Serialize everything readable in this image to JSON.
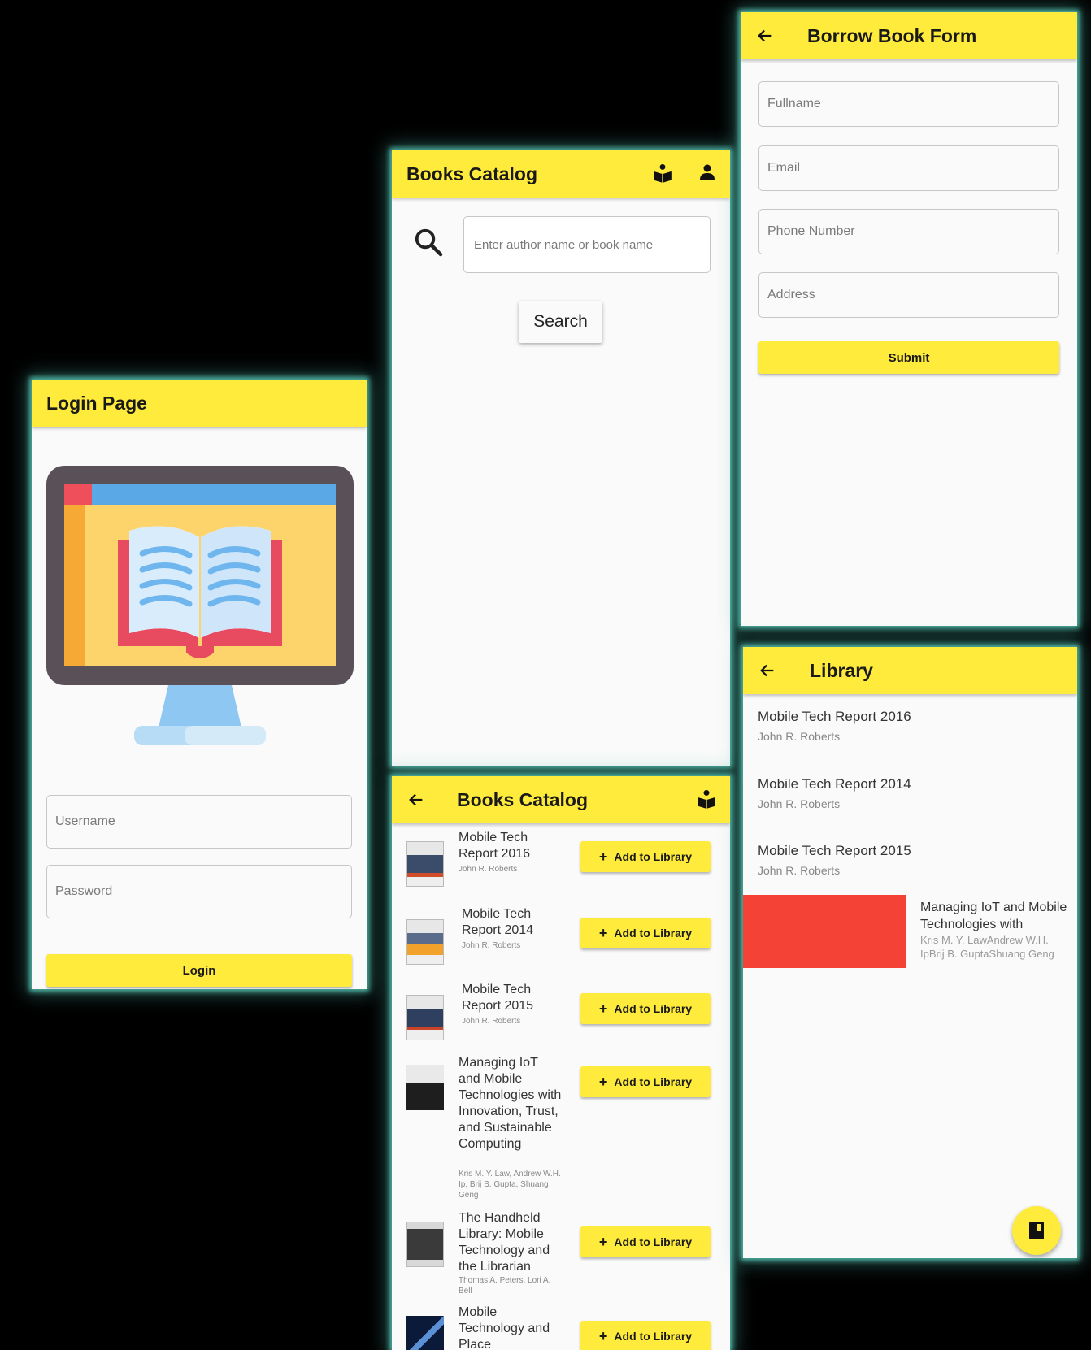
{
  "login": {
    "title": "Login Page",
    "username_placeholder": "Username",
    "password_placeholder": "Password",
    "login_label": "Login"
  },
  "catalog_search": {
    "title": "Books Catalog",
    "search_placeholder": "Enter author name or book name",
    "search_label": "Search"
  },
  "catalog_results": {
    "title": "Books Catalog",
    "add_label": "Add to Library",
    "books": [
      {
        "title": "Mobile Tech Report 2016",
        "author": "John R. Roberts"
      },
      {
        "title": "Mobile Tech Report 2014",
        "author": "John R. Roberts"
      },
      {
        "title": "Mobile Tech Report 2015",
        "author": "John R. Roberts"
      },
      {
        "title": "Managing IoT and Mobile Technologies with Innovation, Trust, and Sustainable Computing",
        "author": "Kris M. Y. Law, Andrew W.H. Ip, Brij B. Gupta, Shuang Geng"
      },
      {
        "title": "The Handheld Library: Mobile Technology and the Librarian",
        "author": "Thomas A. Peters, Lori A. Bell"
      },
      {
        "title": "Mobile Technology and Place",
        "author": ""
      }
    ]
  },
  "borrow_form": {
    "title": "Borrow Book Form",
    "fullname_placeholder": "Fullname",
    "email_placeholder": "Email",
    "phone_placeholder": "Phone Number",
    "address_placeholder": "Address",
    "submit_label": "Submit"
  },
  "library": {
    "title": "Library",
    "items": [
      {
        "title": "Mobile Tech Report 2016",
        "author": "John R. Roberts"
      },
      {
        "title": "Mobile Tech Report 2014",
        "author": "John R. Roberts"
      },
      {
        "title": "Mobile Tech Report 2015",
        "author": "John R. Roberts"
      },
      {
        "title": "Managing IoT and Mobile Technologies with Innovation, Trust, and Sustainable Computing",
        "author": "Kris M. Y. LawAndrew W.H. IpBrij B. GuptaShuang Geng"
      }
    ]
  },
  "colors": {
    "accent": "#ffeb3b",
    "glow": "#4fb5a6",
    "background": "#000000",
    "red_block": "#f44336"
  },
  "icons": [
    "arrow-left-icon",
    "book-reader-icon",
    "person-icon",
    "search-icon",
    "book-icon",
    "plus-icon"
  ]
}
